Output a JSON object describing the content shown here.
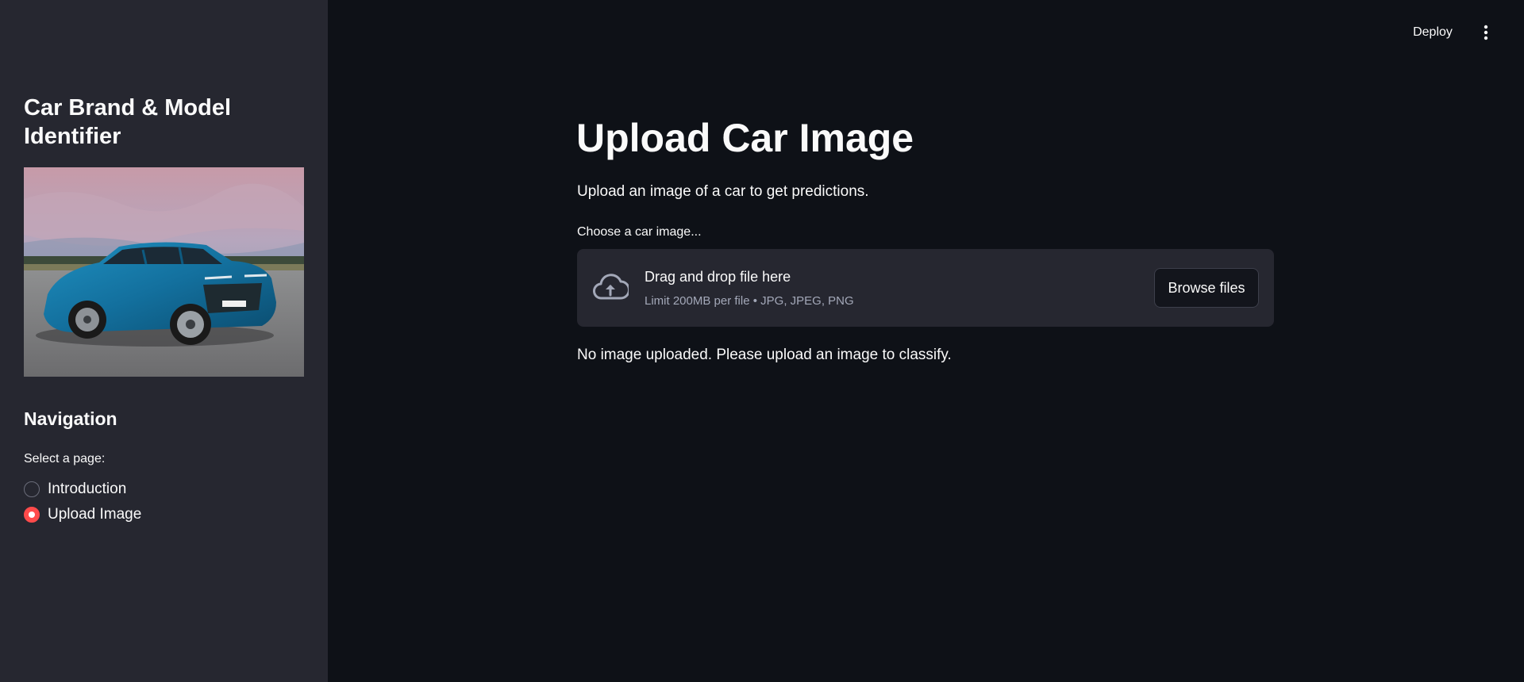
{
  "sidebar": {
    "title": "Car Brand & Model Identifier",
    "navigation_heading": "Navigation",
    "select_label": "Select a page:",
    "options": [
      {
        "label": "Introduction",
        "selected": false
      },
      {
        "label": "Upload Image",
        "selected": true
      }
    ]
  },
  "header": {
    "deploy_label": "Deploy",
    "menu_icon": "more-vertical-icon"
  },
  "main": {
    "title": "Upload Car Image",
    "description": "Upload an image of a car to get predictions.",
    "uploader": {
      "label": "Choose a car image...",
      "dropzone_title": "Drag and drop file here",
      "dropzone_subtitle": "Limit 200MB per file • JPG, JPEG, PNG",
      "browse_label": "Browse files",
      "icon": "cloud-upload-icon"
    },
    "status_message": "No image uploaded. Please upload an image to classify."
  },
  "colors": {
    "background": "#0e1117",
    "sidebar": "#262730",
    "accent": "#ff4b4b",
    "text": "#fafafa"
  }
}
